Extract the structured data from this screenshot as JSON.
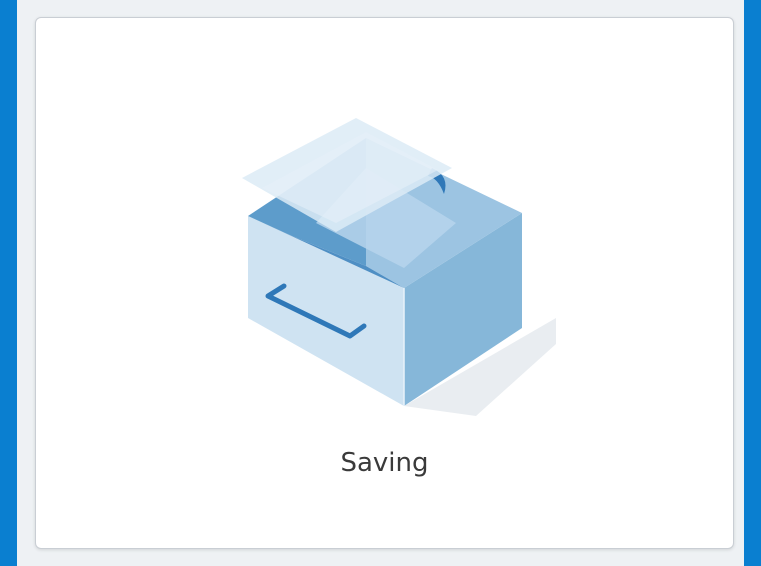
{
  "card": {
    "label": "Saving",
    "icon": "open-box-icon"
  },
  "colors": {
    "frame": "#0a7fd0",
    "panel": "#eef1f4",
    "card": "#ffffff",
    "box_left": "#c9e0f0",
    "box_right": "#86b6d8",
    "box_inner": "#4f8fc4",
    "handle": "#2f78b8",
    "lid": "#dcebf6"
  }
}
